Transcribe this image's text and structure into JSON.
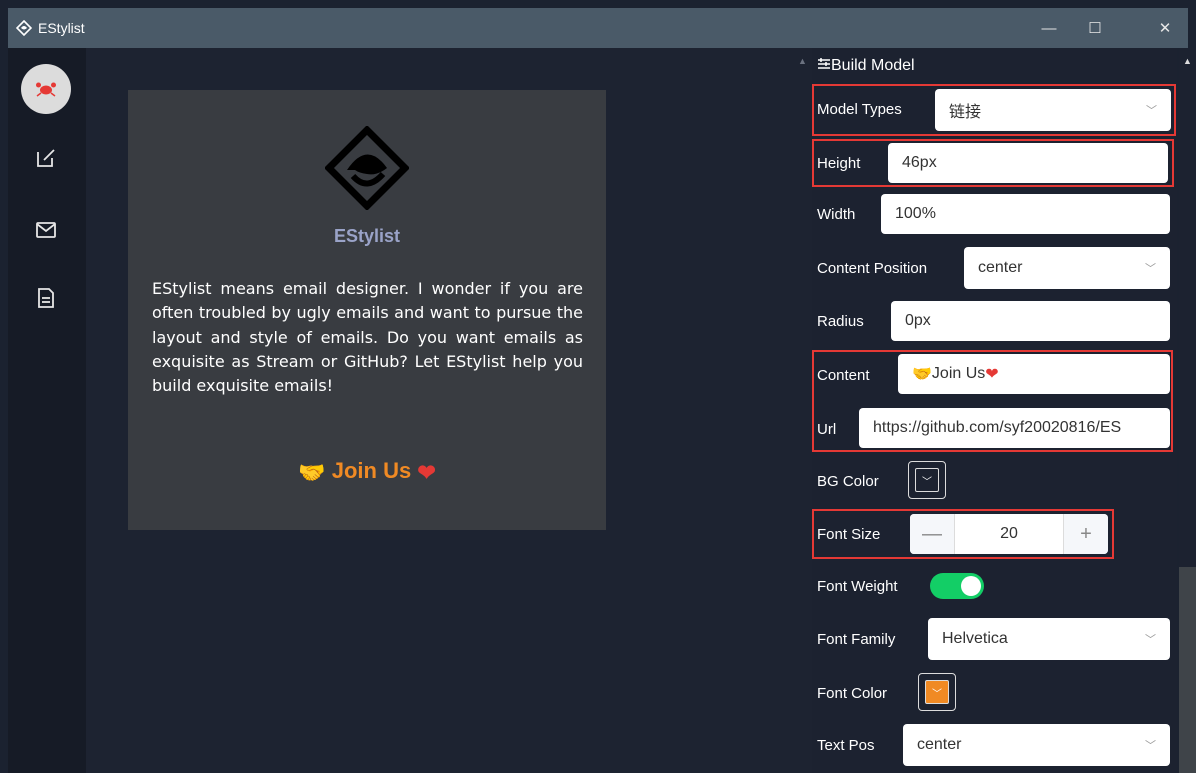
{
  "window": {
    "title": "EStylist",
    "minimize_glyph": "—",
    "maximize_glyph": "☐",
    "close_glyph": "✕"
  },
  "sidebar": {
    "items": [
      {
        "name": "avatar",
        "icon": "crab-icon"
      },
      {
        "name": "edit",
        "icon": "edit-icon"
      },
      {
        "name": "mail",
        "icon": "mail-icon"
      },
      {
        "name": "document",
        "icon": "document-icon"
      }
    ]
  },
  "preview": {
    "brand": "EStylist",
    "description": "EStylist means email designer. I wonder if you are often troubled by ugly emails and want to pursue the layout and style of emails. Do you want emails as exquisite as Stream or GitHub? Let EStylist help you build exquisite emails!",
    "button_text": "Join Us",
    "button_emoji_left": "🤝",
    "button_emoji_right": "❤",
    "button_color": "#f08a24"
  },
  "panel": {
    "title": "Build Model",
    "model_types": {
      "label": "Model Types",
      "value": "链接"
    },
    "height": {
      "label": "Height",
      "value": "46px"
    },
    "width": {
      "label": "Width",
      "value": "100%"
    },
    "content_position": {
      "label": "Content Position",
      "value": "center"
    },
    "radius": {
      "label": "Radius",
      "value": "0px"
    },
    "content": {
      "label": "Content",
      "value": "Join Us",
      "emoji_left": "🤝",
      "emoji_right": "❤"
    },
    "url": {
      "label": "Url",
      "value": "https://github.com/syf20020816/ES"
    },
    "bg_color": {
      "label": "BG Color",
      "color": "#1c2230"
    },
    "font_size": {
      "label": "Font Size",
      "value": "20",
      "minus": "—",
      "plus": "+"
    },
    "font_weight": {
      "label": "Font Weight",
      "on": true
    },
    "font_family": {
      "label": "Font Family",
      "value": "Helvetica"
    },
    "font_color": {
      "label": "Font Color",
      "color": "#f08a24"
    },
    "text_pos": {
      "label": "Text Pos",
      "value": "center"
    }
  },
  "colors": {
    "highlight": "#e53935",
    "toggle_on": "#13ce66",
    "accent": "#f08a24"
  }
}
